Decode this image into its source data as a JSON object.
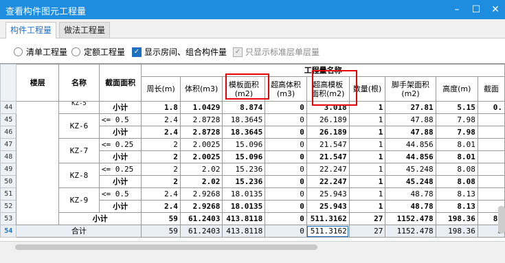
{
  "window": {
    "title": "查看构件图元工程量",
    "minimize": "–",
    "maximize": "☐",
    "close": "✕"
  },
  "tabs": [
    {
      "label": "构件工程量"
    },
    {
      "label": "做法工程量"
    }
  ],
  "options": {
    "radio1": "清单工程量",
    "radio2": "定额工程量",
    "check1": "显示房间、组合构件量",
    "check2": "只显示标准层单层量"
  },
  "header": {
    "floor": "楼层",
    "name": "名称",
    "section": "截面面积",
    "group": "工程量名称",
    "cols": [
      "周长(m)",
      "体积(m3)",
      "模板面积(m2)",
      "超高体积(m3)",
      "超高模板面积(m2)",
      "数量(根)",
      "脚手架面积(m2)",
      "高度(m)",
      "截面"
    ]
  },
  "row_numbers": [
    "44",
    "45",
    "46",
    "47",
    "48",
    "49",
    "50",
    "51",
    "52",
    "53",
    "54"
  ],
  "rows": [
    {
      "name": "KZ-5",
      "section": "小计",
      "values": [
        "1.8",
        "1.0429",
        "8.874",
        "0",
        "3.018",
        "1",
        "27.81",
        "5.15",
        "0."
      ]
    },
    {
      "name": "KZ-6",
      "section": "<= 0.5",
      "values": [
        "2.4",
        "2.8728",
        "18.3645",
        "0",
        "26.189",
        "1",
        "47.88",
        "7.98",
        ""
      ]
    },
    {
      "name": "",
      "section": "小计",
      "values": [
        "2.4",
        "2.8728",
        "18.3645",
        "0",
        "26.189",
        "1",
        "47.88",
        "7.98",
        ""
      ]
    },
    {
      "name": "KZ-7",
      "section": "<= 0.25",
      "values": [
        "2",
        "2.0025",
        "15.096",
        "0",
        "21.547",
        "1",
        "44.856",
        "8.01",
        ""
      ]
    },
    {
      "name": "",
      "section": "小计",
      "values": [
        "2",
        "2.0025",
        "15.096",
        "0",
        "21.547",
        "1",
        "44.856",
        "8.01",
        ""
      ]
    },
    {
      "name": "KZ-8",
      "section": "<= 0.25",
      "values": [
        "2",
        "2.02",
        "15.236",
        "0",
        "22.247",
        "1",
        "45.248",
        "8.08",
        ""
      ]
    },
    {
      "name": "",
      "section": "小计",
      "values": [
        "2",
        "2.02",
        "15.236",
        "0",
        "22.247",
        "1",
        "45.248",
        "8.08",
        ""
      ]
    },
    {
      "name": "KZ-9",
      "section": "<= 0.5",
      "values": [
        "2.4",
        "2.9268",
        "18.0135",
        "0",
        "25.943",
        "1",
        "48.78",
        "8.13",
        ""
      ]
    },
    {
      "name": "",
      "section": "小计",
      "values": [
        "2.4",
        "2.9268",
        "18.0135",
        "0",
        "25.943",
        "1",
        "48.78",
        "8.13",
        ""
      ]
    }
  ],
  "subtotal": {
    "label": "小计",
    "values": [
      "59",
      "61.2403",
      "413.8118",
      "0",
      "511.3162",
      "27",
      "1152.478",
      "198.36",
      "8."
    ]
  },
  "total": {
    "label": "合计",
    "values": [
      "59",
      "61.2403",
      "413.8118",
      "0",
      "511.3162",
      "27",
      "1152.478",
      "198.36",
      "8"
    ]
  }
}
